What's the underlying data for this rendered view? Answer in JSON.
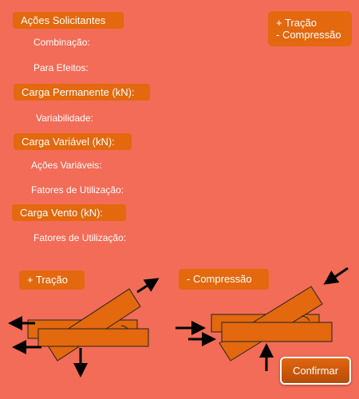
{
  "form": {
    "acoes_title": "Ações Solicitantes",
    "combinacao_label": "Combinação:",
    "para_efeitos_label": "Para Efeitos:",
    "carga_permanente_title": "Carga Permanente (kN):",
    "variabilidade_label": "Variabilidade:",
    "carga_variavel_title": "Carga Variável (kN):",
    "acoes_variaveis_label": "Ações Variáveis:",
    "fatores_utilizacao_label_1": "Fatores de Utilização:",
    "carga_vento_title": "Carga Vento (kN):",
    "fatores_utilizacao_label_2": "Fatores de Utilização:"
  },
  "legend": {
    "tracao": "+ Tração",
    "compressao": "- Compressão"
  },
  "diagrams": {
    "tracao_label": "+ Tração",
    "compressao_label": "- Compressão"
  },
  "buttons": {
    "confirm_label": "Confirmar"
  },
  "colors": {
    "background": "#f26c57",
    "accent": "#e3680e",
    "text": "#ffffff",
    "arrow": "#000000"
  },
  "icons": [
    "arrow-icon"
  ]
}
